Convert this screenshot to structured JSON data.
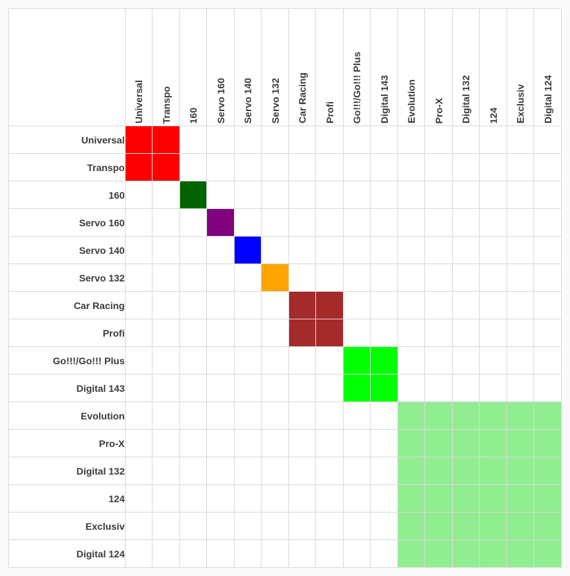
{
  "labels": [
    "Universal",
    "Transpo",
    "160",
    "Servo 160",
    "Servo 140",
    "Servo 132",
    "Car Racing",
    "Profi",
    "Go!!!/Go!!! Plus",
    "Digital 143",
    "Evolution",
    "Pro-X",
    "Digital 132",
    "124",
    "Exclusiv",
    "Digital 124"
  ],
  "palette": {
    "red": "#ff0000",
    "darkgreen": "#006400",
    "purple": "#800080",
    "blue": "#0000ff",
    "orange": "#ffa500",
    "brown": "#a52a2a",
    "lime": "#00ff00",
    "lightgreen": "#90ee90"
  },
  "groups": [
    {
      "members": [
        0,
        1
      ],
      "color": "red"
    },
    {
      "members": [
        2
      ],
      "color": "darkgreen"
    },
    {
      "members": [
        3
      ],
      "color": "purple"
    },
    {
      "members": [
        4
      ],
      "color": "blue"
    },
    {
      "members": [
        5
      ],
      "color": "orange"
    },
    {
      "members": [
        6,
        7
      ],
      "color": "brown"
    },
    {
      "members": [
        8,
        9
      ],
      "color": "lime"
    },
    {
      "members": [
        10,
        11,
        12,
        13,
        14,
        15
      ],
      "color": "lightgreen"
    }
  ],
  "chart_data": {
    "type": "heatmap",
    "title": "",
    "xlabel": "",
    "ylabel": "",
    "categories": [
      "Universal",
      "Transpo",
      "160",
      "Servo 160",
      "Servo 140",
      "Servo 132",
      "Car Racing",
      "Profi",
      "Go!!!/Go!!! Plus",
      "Digital 143",
      "Evolution",
      "Pro-X",
      "Digital 132",
      "124",
      "Exclusiv",
      "Digital 124"
    ],
    "series": [
      {
        "name": "Universal",
        "values": [
          "red",
          "red",
          "",
          "",
          "",
          "",
          "",
          "",
          "",
          "",
          "",
          "",
          "",
          "",
          "",
          ""
        ]
      },
      {
        "name": "Transpo",
        "values": [
          "red",
          "red",
          "",
          "",
          "",
          "",
          "",
          "",
          "",
          "",
          "",
          "",
          "",
          "",
          "",
          ""
        ]
      },
      {
        "name": "160",
        "values": [
          "",
          "",
          "darkgreen",
          "",
          "",
          "",
          "",
          "",
          "",
          "",
          "",
          "",
          "",
          "",
          "",
          ""
        ]
      },
      {
        "name": "Servo 160",
        "values": [
          "",
          "",
          "",
          "purple",
          "",
          "",
          "",
          "",
          "",
          "",
          "",
          "",
          "",
          "",
          "",
          ""
        ]
      },
      {
        "name": "Servo 140",
        "values": [
          "",
          "",
          "",
          "",
          "blue",
          "",
          "",
          "",
          "",
          "",
          "",
          "",
          "",
          "",
          "",
          ""
        ]
      },
      {
        "name": "Servo 132",
        "values": [
          "",
          "",
          "",
          "",
          "",
          "orange",
          "",
          "",
          "",
          "",
          "",
          "",
          "",
          "",
          "",
          ""
        ]
      },
      {
        "name": "Car Racing",
        "values": [
          "",
          "",
          "",
          "",
          "",
          "",
          "brown",
          "brown",
          "",
          "",
          "",
          "",
          "",
          "",
          "",
          ""
        ]
      },
      {
        "name": "Profi",
        "values": [
          "",
          "",
          "",
          "",
          "",
          "",
          "brown",
          "brown",
          "",
          "",
          "",
          "",
          "",
          "",
          "",
          ""
        ]
      },
      {
        "name": "Go!!!/Go!!! Plus",
        "values": [
          "",
          "",
          "",
          "",
          "",
          "",
          "",
          "",
          "lime",
          "lime",
          "",
          "",
          "",
          "",
          "",
          ""
        ]
      },
      {
        "name": "Digital 143",
        "values": [
          "",
          "",
          "",
          "",
          "",
          "",
          "",
          "",
          "lime",
          "lime",
          "",
          "",
          "",
          "",
          "",
          ""
        ]
      },
      {
        "name": "Evolution",
        "values": [
          "",
          "",
          "",
          "",
          "",
          "",
          "",
          "",
          "",
          "",
          "lightgreen",
          "lightgreen",
          "lightgreen",
          "lightgreen",
          "lightgreen",
          "lightgreen"
        ]
      },
      {
        "name": "Pro-X",
        "values": [
          "",
          "",
          "",
          "",
          "",
          "",
          "",
          "",
          "",
          "",
          "lightgreen",
          "lightgreen",
          "lightgreen",
          "lightgreen",
          "lightgreen",
          "lightgreen"
        ]
      },
      {
        "name": "Digital 132",
        "values": [
          "",
          "",
          "",
          "",
          "",
          "",
          "",
          "",
          "",
          "",
          "lightgreen",
          "lightgreen",
          "lightgreen",
          "lightgreen",
          "lightgreen",
          "lightgreen"
        ]
      },
      {
        "name": "124",
        "values": [
          "",
          "",
          "",
          "",
          "",
          "",
          "",
          "",
          "",
          "",
          "lightgreen",
          "lightgreen",
          "lightgreen",
          "lightgreen",
          "lightgreen",
          "lightgreen"
        ]
      },
      {
        "name": "Exclusiv",
        "values": [
          "",
          "",
          "",
          "",
          "",
          "",
          "",
          "",
          "",
          "",
          "lightgreen",
          "lightgreen",
          "lightgreen",
          "lightgreen",
          "lightgreen",
          "lightgreen"
        ]
      },
      {
        "name": "Digital 124",
        "values": [
          "",
          "",
          "",
          "",
          "",
          "",
          "",
          "",
          "",
          "",
          "lightgreen",
          "lightgreen",
          "lightgreen",
          "lightgreen",
          "lightgreen",
          "lightgreen"
        ]
      }
    ]
  }
}
